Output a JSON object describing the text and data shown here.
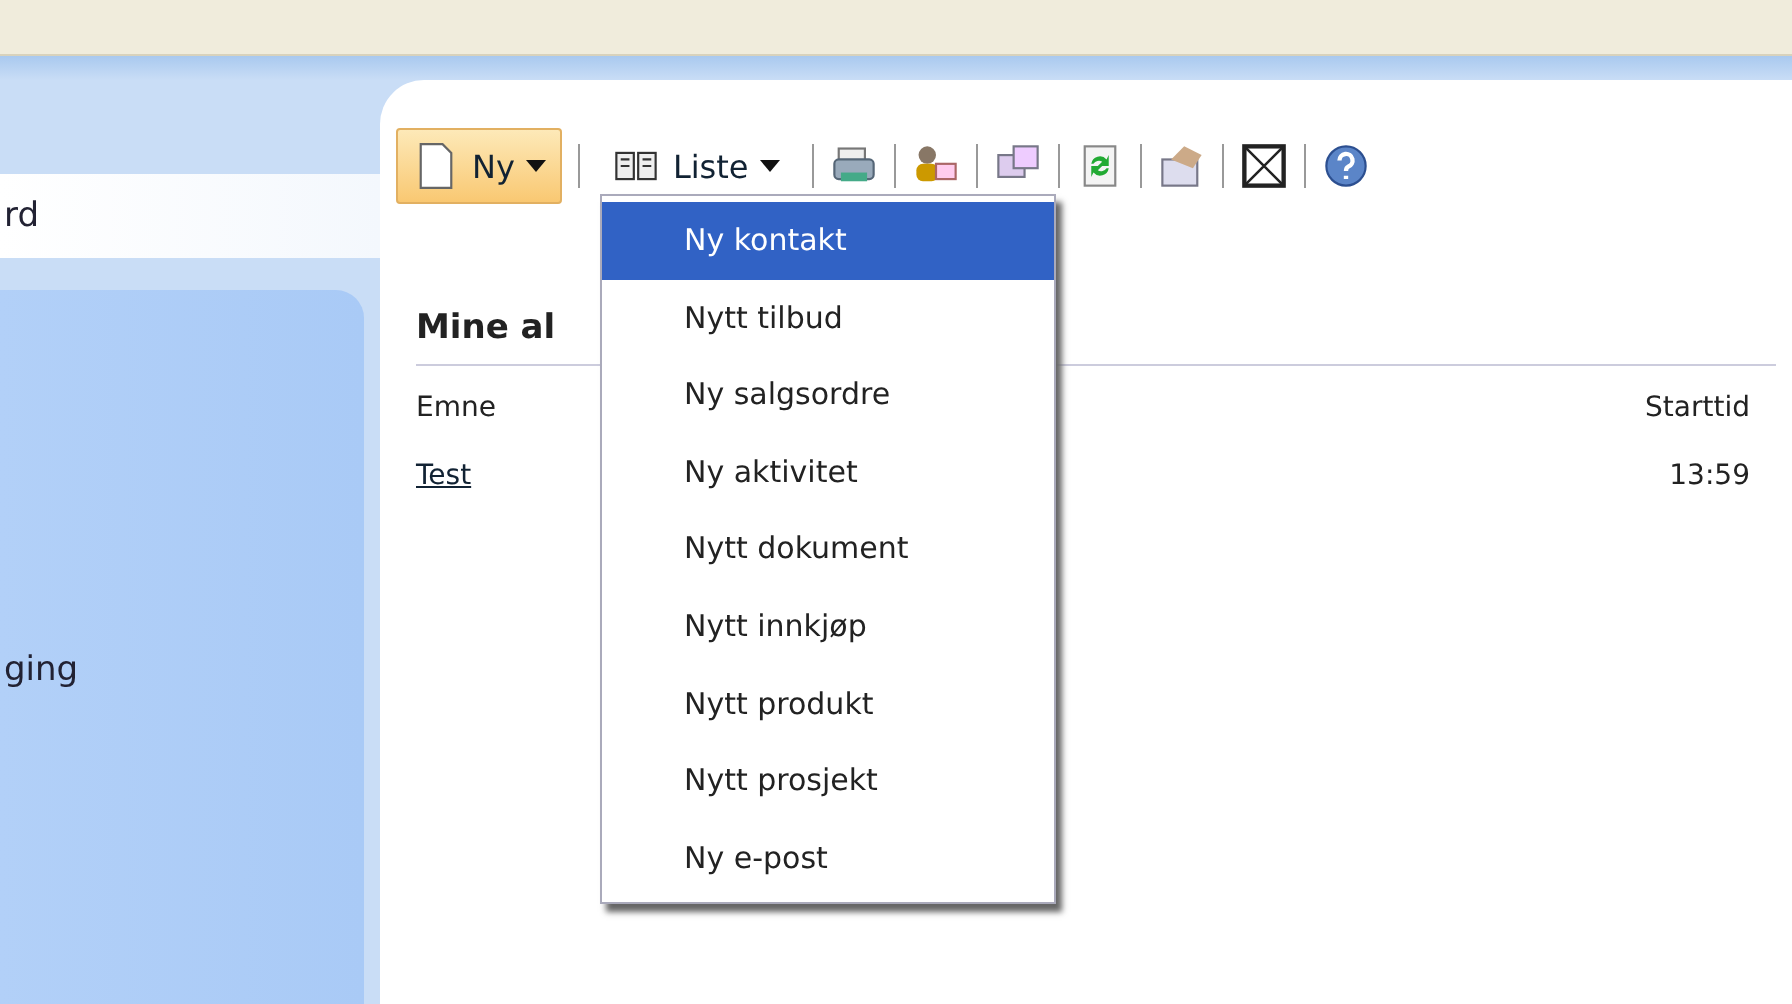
{
  "sidebar": {
    "items": [
      {
        "label": "rd",
        "selected": true
      },
      {
        "label": "ging",
        "selected": false
      }
    ]
  },
  "toolbar": {
    "buttons": [
      {
        "label": "Ny",
        "open": true
      },
      {
        "label": "Liste",
        "open": false
      }
    ]
  },
  "dropdown": {
    "items": [
      {
        "label": "Ny kontakt",
        "selected": true
      },
      {
        "label": "Nytt tilbud",
        "selected": false
      },
      {
        "label": "Ny salgsordre",
        "selected": false
      },
      {
        "label": "Ny aktivitet",
        "selected": false
      },
      {
        "label": "Nytt dokument",
        "selected": false
      },
      {
        "label": "Nytt innkjøp",
        "selected": false
      },
      {
        "label": "Nytt produkt",
        "selected": false
      },
      {
        "label": "Nytt prosjekt",
        "selected": false
      },
      {
        "label": "Ny e-post",
        "selected": false
      }
    ]
  },
  "panel": {
    "title": "Mine al",
    "columns": [
      "Emne",
      "Starttid"
    ],
    "rows": [
      {
        "cells": [
          "Test",
          "13:59"
        ]
      }
    ]
  }
}
